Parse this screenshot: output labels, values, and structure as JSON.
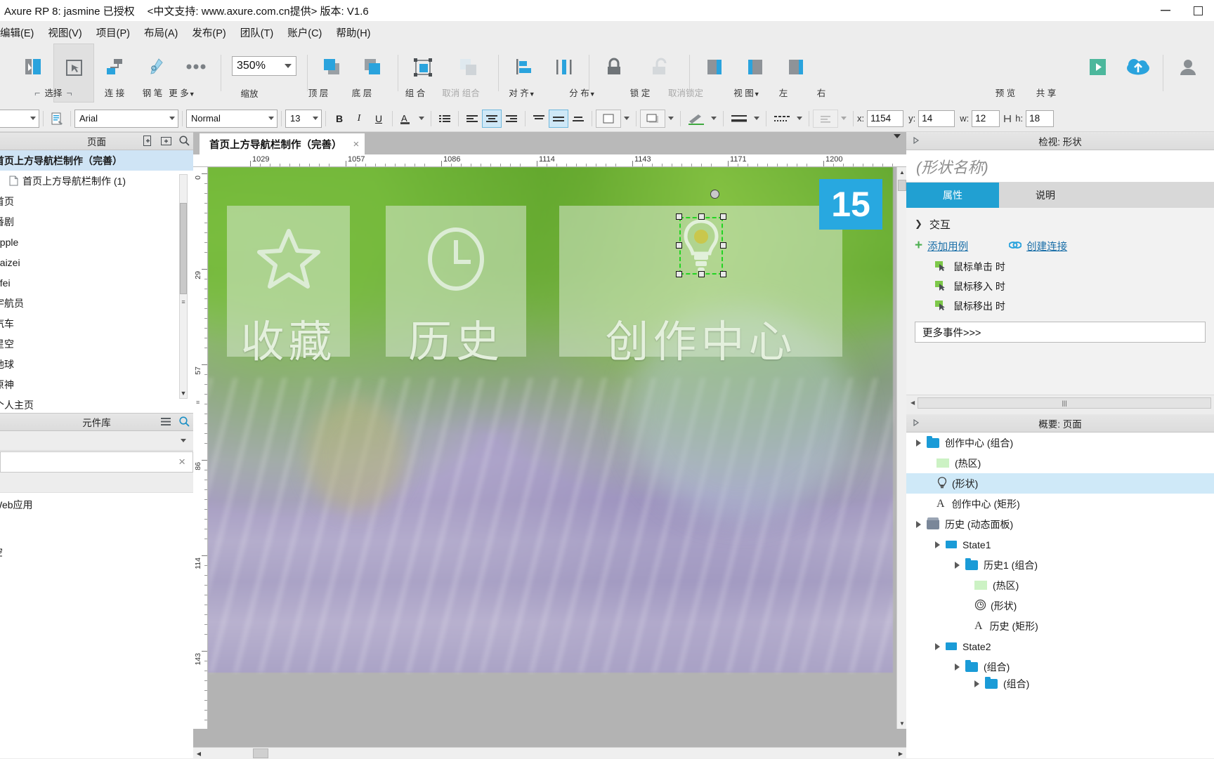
{
  "titlebar": {
    "app_title": "Axure RP 8",
    "license": ": jasmine 已授权",
    "support": "<中文支持: www.axure.com.cn提供>",
    "version": "版本: V1.6",
    "minimize": "minimize-icon",
    "maximize": "maximize-icon"
  },
  "menubar": {
    "items": [
      {
        "label": "编辑(E)"
      },
      {
        "label": "视图(V)"
      },
      {
        "label": "项目(P)"
      },
      {
        "label": "布局(A)"
      },
      {
        "label": "发布(P)"
      },
      {
        "label": "团队(T)"
      },
      {
        "label": "账户(C)"
      },
      {
        "label": "帮助(H)"
      }
    ]
  },
  "toolbar": {
    "select": "选择",
    "connect": "连 接",
    "pen": "钢 笔",
    "more": "更 多",
    "zoom_value": "350%",
    "zoom_label": "缩放",
    "top_layer": "顶 层",
    "bottom_layer": "底 层",
    "group": "组 合",
    "ungroup": "取消 组合",
    "align": "对 齐",
    "distribute": "分 布",
    "lock": "锁 定",
    "unlock": "取消锁定",
    "view": "视 图",
    "left": "左",
    "right": "右",
    "preview": "预 览",
    "share": "共 享"
  },
  "format": {
    "font": "Arial",
    "weight": "Normal",
    "size": "13",
    "bold": "B",
    "italic": "I",
    "underline": "U",
    "font_color": "A",
    "x_label": "x:",
    "x_value": "1154",
    "y_label": "y:",
    "y_value": "14",
    "w_label": "w:",
    "w_value": "12",
    "h_label": "h:",
    "h_value": "18"
  },
  "pages": {
    "title": "页面",
    "items": [
      {
        "label": "首页上方导航栏制作（完善）",
        "selected": true,
        "indent": 0,
        "icon": "none"
      },
      {
        "label": "首页上方导航栏制作 (1)",
        "selected": false,
        "indent": 1,
        "icon": "page-icon"
      },
      {
        "label": "首页",
        "selected": false,
        "indent": 0,
        "icon": "none"
      },
      {
        "label": "番剧",
        "selected": false,
        "indent": 0,
        "icon": "none"
      },
      {
        "label": "apple",
        "selected": false,
        "indent": 0,
        "icon": "none"
      },
      {
        "label": "haizei",
        "selected": false,
        "indent": 0,
        "icon": "none"
      },
      {
        "label": "ufei",
        "selected": false,
        "indent": 0,
        "icon": "none"
      },
      {
        "label": "宇航员",
        "selected": false,
        "indent": 0,
        "icon": "none"
      },
      {
        "label": "汽车",
        "selected": false,
        "indent": 0,
        "icon": "none"
      },
      {
        "label": "星空",
        "selected": false,
        "indent": 0,
        "icon": "none"
      },
      {
        "label": "地球",
        "selected": false,
        "indent": 0,
        "icon": "none"
      },
      {
        "label": "原神",
        "selected": false,
        "indent": 0,
        "icon": "none"
      },
      {
        "label": "个人主页",
        "selected": false,
        "indent": 0,
        "icon": "none"
      }
    ]
  },
  "library": {
    "title": "元件库",
    "group_label": "",
    "items": [
      {
        "label": "Web应用"
      },
      {
        "label": ""
      },
      {
        "label": "空"
      }
    ]
  },
  "canvas": {
    "tab_label": "首页上方导航栏制作（完善）",
    "tab_close": "×",
    "ruler_labels": [
      "1029",
      "1057",
      "1086",
      "1114",
      "1143",
      "1171",
      "1200"
    ],
    "ruler_v_labels": [
      "0",
      "29",
      "57",
      "86",
      "114",
      "143"
    ],
    "badge": "15",
    "tiles": [
      {
        "icon": "star-icon",
        "label": "收藏"
      },
      {
        "icon": "clock-icon",
        "label": "历史"
      },
      {
        "icon": "bulb-icon",
        "label": "创作中心"
      }
    ]
  },
  "inspector": {
    "title": "检视: 形状",
    "name_placeholder": "(形状名称)",
    "tabs": [
      {
        "label": "属性",
        "active": true
      },
      {
        "label": "说明",
        "active": false
      }
    ],
    "section_interaction": "交互",
    "add_case": "添加用例",
    "create_link": "创建连接",
    "events": [
      {
        "label": "鼠标单击 时"
      },
      {
        "label": "鼠标移入 时"
      },
      {
        "label": "鼠标移出 时"
      }
    ],
    "more_events": "更多事件>>>"
  },
  "outline": {
    "title": "概要: 页面",
    "rows": [
      {
        "label": "创作中心 (组合)",
        "indent": 0,
        "icon": "folder-icon",
        "arrow": true,
        "selected": false
      },
      {
        "label": "(热区)",
        "indent": 1,
        "icon": "hotzone-icon",
        "arrow": false,
        "selected": false
      },
      {
        "label": "(形状)",
        "indent": 1,
        "icon": "bulb-icon",
        "arrow": false,
        "selected": true
      },
      {
        "label": "创作中心 (矩形)",
        "indent": 1,
        "icon": "text-icon",
        "arrow": false,
        "selected": false
      },
      {
        "label": "历史 (动态面板)",
        "indent": 0,
        "icon": "dynpanel-icon",
        "arrow": true,
        "selected": false
      },
      {
        "label": "State1",
        "indent": 1,
        "icon": "state-icon",
        "arrow": true,
        "selected": false
      },
      {
        "label": "历史1 (组合)",
        "indent": 2,
        "icon": "folder-icon",
        "arrow": true,
        "selected": false
      },
      {
        "label": "(热区)",
        "indent": 3,
        "icon": "hotzone-icon",
        "arrow": false,
        "selected": false
      },
      {
        "label": "(形状)",
        "indent": 3,
        "icon": "clock-icon",
        "arrow": false,
        "selected": false
      },
      {
        "label": "历史 (矩形)",
        "indent": 3,
        "icon": "text-icon",
        "arrow": false,
        "selected": false
      },
      {
        "label": "State2",
        "indent": 1,
        "icon": "state-icon",
        "arrow": true,
        "selected": false
      },
      {
        "label": "(组合)",
        "indent": 2,
        "icon": "folder-icon",
        "arrow": true,
        "selected": false
      },
      {
        "label": "(组合)",
        "indent": 3,
        "icon": "folder-icon",
        "arrow": true,
        "selected": false
      }
    ]
  },
  "colors": {
    "accent": "#21a0d2",
    "selection_green": "#22d422",
    "badge_blue": "#28a8e0",
    "link": "#1b6fa8"
  }
}
